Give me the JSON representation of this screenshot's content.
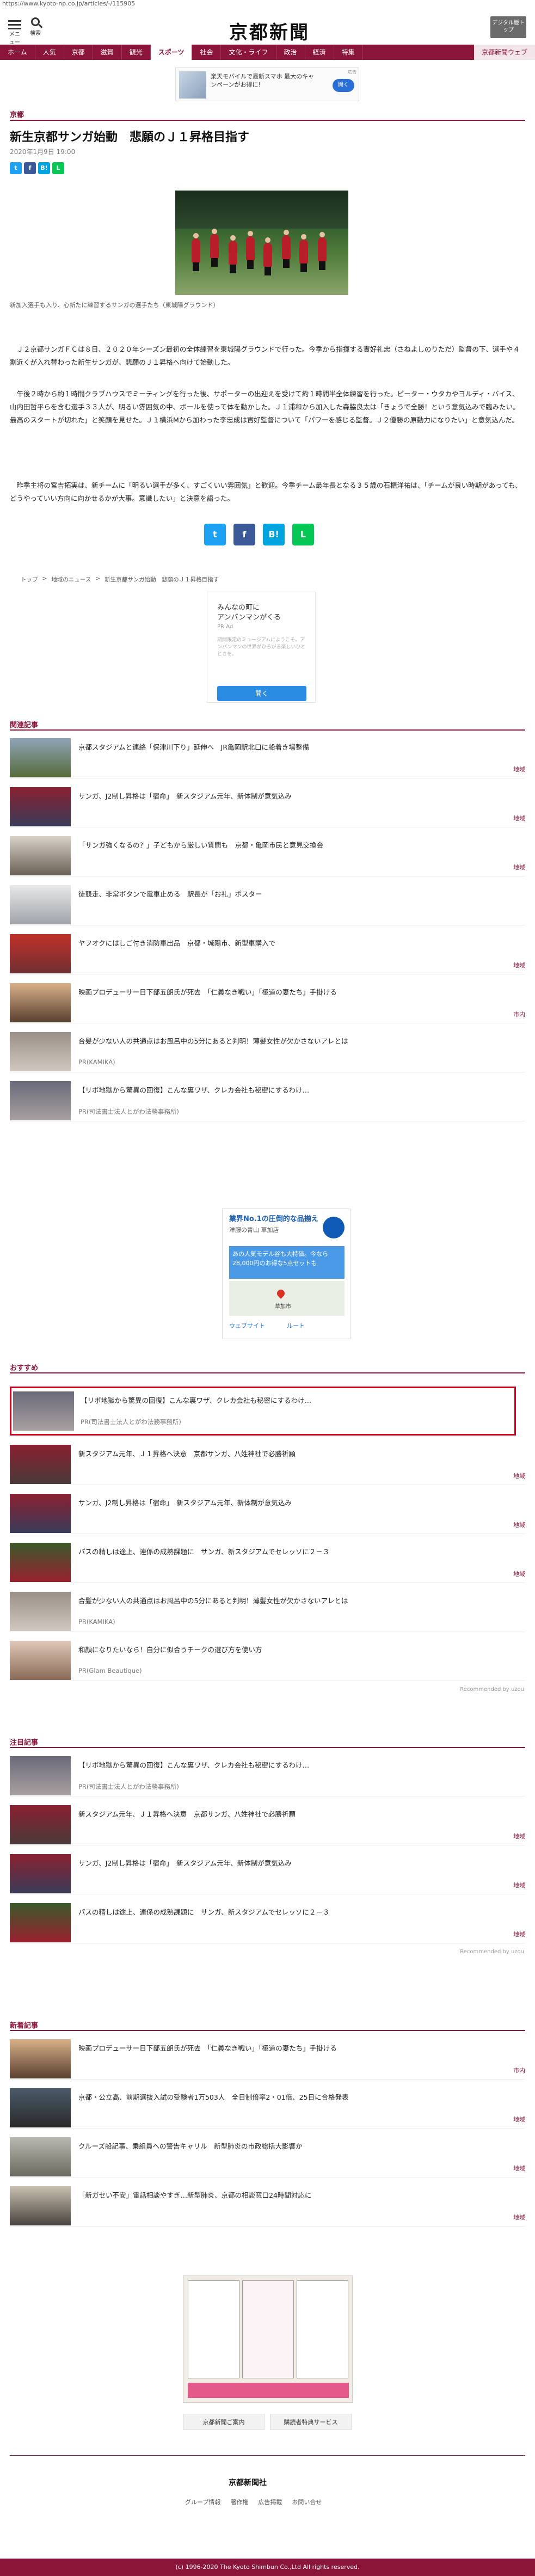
{
  "url": "https://www.kyoto-np.co.jp/articles/-/115905",
  "header": {
    "menu_label": "メニュー",
    "search_label": "検索",
    "logo": "京都新聞",
    "digital_btn": "デジタル版トップ"
  },
  "nav": [
    "ホーム",
    "人気",
    "京都",
    "滋賀",
    "観光",
    "スポーツ",
    "社会",
    "文化・ライフ",
    "政治",
    "経済",
    "特集",
    "京都新聞ウェブ"
  ],
  "top_ad": {
    "text": "楽天モバイルで最新スマホ 最大のキャンペーンがお得に!",
    "cta": "開く",
    "label": "広告"
  },
  "article": {
    "section": "京都",
    "title": "新生京都サンガ始動　悲願のＪ１昇格目指す",
    "date": "2020年1月9日 19:00",
    "caption": "新加入選手も入り、心新たに練習するサンガの選手たち（東城陽グラウンド）",
    "p1": "　Ｊ２京都サンガＦＣは８日、２０２０年シーズン最初の全体練習を東城陽グラウンドで行った。今季から指揮する實好礼忠（さねよしのりただ）監督の下、選手や４割近くが入れ替わった新生サンガが、悲願のＪ１昇格へ向けて始動した。",
    "p2": "　午後２時から約１時間クラブハウスでミーティングを行った後、サポーターの出迎えを受けて約１時間半全体練習を行った。ピーター・ウタカやヨルディ・バイス、山内田哲平らを含む選手３３人が、明るい雰囲気の中、ボールを使って体を動かした。Ｊ１浦和から加入した森脇良太は「きょうで全勝！という意気込みで臨みたい。最高のスタートが切れた」と笑顔を見せた。Ｊ１横浜Mから加わった李忠成は實好監督について「パワーを感じる監督。Ｊ２優勝の原動力になりたい」と意気込んだ。",
    "p3": "　昨季主将の宮吉拓実は、新チームに「明るい選手が多く、すごくいい雰囲気」と歓迎。今季チーム最年長となる３５歳の石櫃洋祐は、「チームが良い時期があっても、どうやっていい方向に向かせるかが大事。意識したい」と決意を語った。"
  },
  "breadcrumb": [
    "トップ",
    "地域のニュース",
    "新生京都サンガ始動　悲願のＪ１昇格目指す"
  ],
  "mid_ad": {
    "title": "みんなの町に\nアンパンマンがくる",
    "sub": "PR Ad",
    "desc": "期間限定のミュージアムにようこそ。アンパンマンの世界がひろがる楽しいひとときを。",
    "cta": "開く"
  },
  "related": {
    "label": "関連記事",
    "items": [
      {
        "title": "京都スタジアムと連絡「保津川下り」延伸へ　JR亀岡駅北口に船着き場整備",
        "tag": "地域"
      },
      {
        "title": "サンガ、J2制し昇格は「宿命」　新スタジアム元年、新体制が意気込み",
        "tag": "地域"
      },
      {
        "title": "「サンガ強くなるの？」子どもから厳しい質問も　京都・亀岡市民と意見交換会",
        "tag": "地域"
      },
      {
        "title": "徒競走、非常ボタンで電車止める　駅長が「お礼」ポスター",
        "tag": ""
      },
      {
        "title": "ヤフオクにはしご付き消防車出品　京都・城陽市、新型車購入で",
        "tag": "地域"
      },
      {
        "title": "映画プロデューサー日下部五朗氏が死去　「仁義なき戦い」「極道の妻たち」手掛ける",
        "tag": "市内"
      },
      {
        "title": "合髪が少ない人の共通点はお風呂中の5分にあると判明！薄髪女性が欠かさないアレとは",
        "tag": "",
        "pr": "PR(KAMIKA)"
      },
      {
        "title": "【リボ地獄から驚異の回復】こんな裏ワザ、クレカ会社も秘密にするわけ…",
        "tag": "",
        "pr": "PR(司法書士法人とがわ法務事務所)"
      }
    ]
  },
  "map_ad": {
    "title": "業界No.1の圧倒的な品揃え",
    "sub": "洋服の青山 草加店",
    "blue": "あの人気モデル谷も大特価。今なら28,000円のお得な5点セットも",
    "place": "草加市",
    "web": "ウェブサイト",
    "route": "ルート"
  },
  "recommend": {
    "label": "おすすめ",
    "items": [
      {
        "title": "【リボ地獄から驚異の回復】こんな裏ワザ、クレカ会社も秘密にするわけ…",
        "pr": "PR(司法書士法人とがわ法務事務所)"
      },
      {
        "title": "新スタジアム元年、Ｊ１昇格へ決意　京都サンガ、八姓神社で必勝祈願",
        "tag": "地域"
      },
      {
        "title": "サンガ、J2制し昇格は「宿命」　新スタジアム元年、新体制が意気込み",
        "tag": "地域"
      },
      {
        "title": "パスの精しは途上、連係の成熟課題に　サンガ、新スタジアムでセレッソに２－３",
        "tag": "地域"
      },
      {
        "title": "合髪が少ない人の共通点はお風呂中の5分にあると判明！薄髪女性が欠かさないアレとは",
        "pr": "PR(KAMIKA)"
      },
      {
        "title": "和顔になりたいなら！自分に似合うチークの選び方を使い方",
        "pr": "PR(Glam Beautique)"
      }
    ],
    "powered": "Recommended by uzou"
  },
  "attention": {
    "label": "注目記事",
    "items": [
      {
        "title": "【リボ地獄から驚異の回復】こんな裏ワザ、クレカ会社も秘密にするわけ…",
        "pr": "PR(司法書士法人とがわ法務事務所)"
      },
      {
        "title": "新スタジアム元年、Ｊ１昇格へ決意　京都サンガ、八姓神社で必勝祈願",
        "tag": "地域"
      },
      {
        "title": "サンガ、J2制し昇格は「宿命」　新スタジアム元年、新体制が意気込み",
        "tag": "地域"
      },
      {
        "title": "パスの精しは途上、連係の成熟課題に　サンガ、新スタジアムでセレッソに２－３",
        "tag": "地域"
      }
    ],
    "powered": "Recommended by uzou"
  },
  "latest": {
    "label": "新着記事",
    "items": [
      {
        "title": "映画プロデューサー日下部五朗氏が死去　「仁義なき戦い」「極道の妻たち」手掛ける",
        "tag": "市内"
      },
      {
        "title": "京都・公立高、前期選抜入試の受験者1万503人　全日制倍率2・01倍、25日に合格発表",
        "tag": "地域"
      },
      {
        "title": "クルーズ船記事、乗組員への警告キャリル　新型肺炎の市政総括大影響か",
        "tag": "地域"
      },
      {
        "title": "「新ガセい不安」電話相談やすぎ…新型肺炎、京都の相談窓口24時間対応に",
        "tag": "地域"
      }
    ]
  },
  "footer": {
    "btn1": "京都新聞ご案内",
    "btn2": "購読者特典サービス",
    "corp": "京都新聞社",
    "links": [
      "グループ情報",
      "著作権",
      "広告掲載",
      "お問い合せ"
    ],
    "copyright": "(c) 1996-2020 The Kyoto Shimbun Co.,Ltd All rights reserved."
  }
}
